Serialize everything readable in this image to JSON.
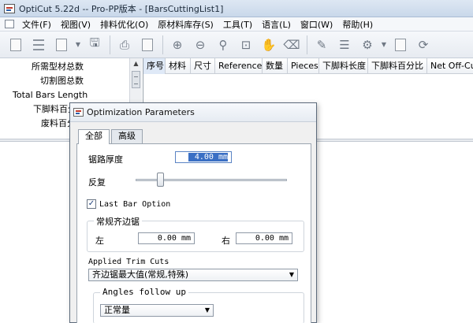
{
  "window": {
    "title": "OptiCut 5.22d -- Pro-PP版本 - [BarsCuttingList1]"
  },
  "menu": [
    "文件(F)",
    "视图(V)",
    "排料优化(O)",
    "原材料库存(S)",
    "工具(T)",
    "语言(L)",
    "窗口(W)",
    "帮助(H)"
  ],
  "toolbar_icons": [
    "new-doc-icon",
    "list-icon",
    "open-icon",
    "save-icon",
    "print-icon",
    "print-preview-icon",
    "zoom-in-icon",
    "zoom-out-icon",
    "zoom-icon",
    "zoom-fit-icon",
    "pan-hand-icon",
    "eraser-icon",
    "edit-icon",
    "list-edit-icon",
    "settings-icon",
    "document-icon",
    "optimize-icon"
  ],
  "left_panel": {
    "items": [
      "所需型材总数",
      "切割图总数",
      "Total Bars Length",
      "下脚料百分",
      "废料百分"
    ]
  },
  "grid": {
    "columns": [
      "序号",
      "材料",
      "尺寸",
      "Reference",
      "数量",
      "Pieces",
      "下脚料长度",
      "下脚料百分比",
      "Net Off-Cuts"
    ]
  },
  "dialog": {
    "title": "Optimization Parameters",
    "tabs": [
      "全部",
      "高级"
    ],
    "kerf_label": "锯路厚度",
    "kerf_value": "4.00 mm",
    "repeat_label": "反复",
    "repeat_level": 0.15,
    "last_bar_label": "Last Bar Option",
    "last_bar_checked": "✓",
    "trim_group_title": "常规齐边锯",
    "left_label": "左",
    "left_value": "0.00 mm",
    "right_label": "右",
    "right_value": "0.00 mm",
    "applied_trim_label": "Applied Trim Cuts",
    "applied_trim_value": "齐边锯最大值(常规,特殊)",
    "angles_group_title": "Angles follow up",
    "angles_value": "正常量"
  }
}
